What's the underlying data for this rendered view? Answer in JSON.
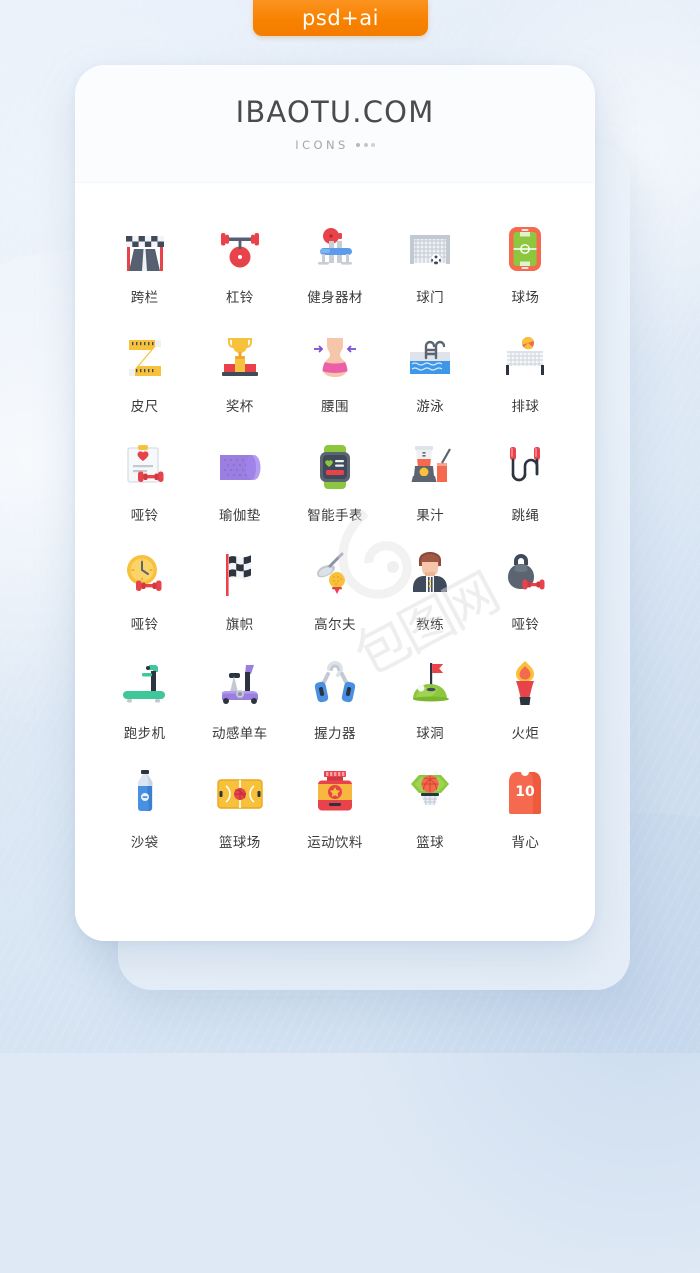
{
  "badge": {
    "label": "psd+ai",
    "color": "#f88200"
  },
  "card": {
    "title": "IBAOTU.COM",
    "subtitle": "ICONS",
    "dots_icon": "three-dots-icon"
  },
  "watermark": {
    "text": "包图网"
  },
  "grid": {
    "columns": 5,
    "items": [
      {
        "label": "跨栏",
        "icon": "hurdle-finish-line-icon"
      },
      {
        "label": "杠铃",
        "icon": "barbell-icon"
      },
      {
        "label": "健身器材",
        "icon": "weight-bench-icon"
      },
      {
        "label": "球门",
        "icon": "soccer-goal-icon"
      },
      {
        "label": "球场",
        "icon": "soccer-field-icon"
      },
      {
        "label": "皮尺",
        "icon": "tape-measure-icon"
      },
      {
        "label": "奖杯",
        "icon": "trophy-podium-icon"
      },
      {
        "label": "腰围",
        "icon": "waistline-icon"
      },
      {
        "label": "游泳",
        "icon": "swimming-pool-icon"
      },
      {
        "label": "排球",
        "icon": "volleyball-net-icon"
      },
      {
        "label": "哑铃",
        "icon": "clipboard-dumbbell-icon"
      },
      {
        "label": "瑜伽垫",
        "icon": "yoga-mat-icon"
      },
      {
        "label": "智能手表",
        "icon": "smart-watch-icon"
      },
      {
        "label": "果汁",
        "icon": "juice-blender-icon"
      },
      {
        "label": "跳绳",
        "icon": "jump-rope-icon"
      },
      {
        "label": "哑铃",
        "icon": "clock-dumbbell-icon"
      },
      {
        "label": "旗帜",
        "icon": "checkered-flag-icon"
      },
      {
        "label": "高尔夫",
        "icon": "golf-club-ball-icon"
      },
      {
        "label": "教练",
        "icon": "coach-referee-icon"
      },
      {
        "label": "哑铃",
        "icon": "kettlebell-dumbbell-icon"
      },
      {
        "label": "跑步机",
        "icon": "treadmill-icon"
      },
      {
        "label": "动感单车",
        "icon": "spinning-bike-icon"
      },
      {
        "label": "握力器",
        "icon": "hand-gripper-icon"
      },
      {
        "label": "球洞",
        "icon": "golf-hole-icon"
      },
      {
        "label": "火炬",
        "icon": "torch-icon"
      },
      {
        "label": "沙袋",
        "icon": "punching-bag-icon"
      },
      {
        "label": "篮球场",
        "icon": "basketball-court-icon"
      },
      {
        "label": "运动饮料",
        "icon": "sports-drink-icon"
      },
      {
        "label": "篮球",
        "icon": "basketball-hoop-icon"
      },
      {
        "label": "背心",
        "icon": "jersey-vest-icon"
      }
    ]
  },
  "palette": {
    "red": "#e8424a",
    "orange": "#f5703c",
    "yellow": "#f8c council",
    "green": "#8dc63f",
    "purple": "#9b7fe0",
    "blue": "#4a90e2",
    "grey": "#5b6470"
  }
}
